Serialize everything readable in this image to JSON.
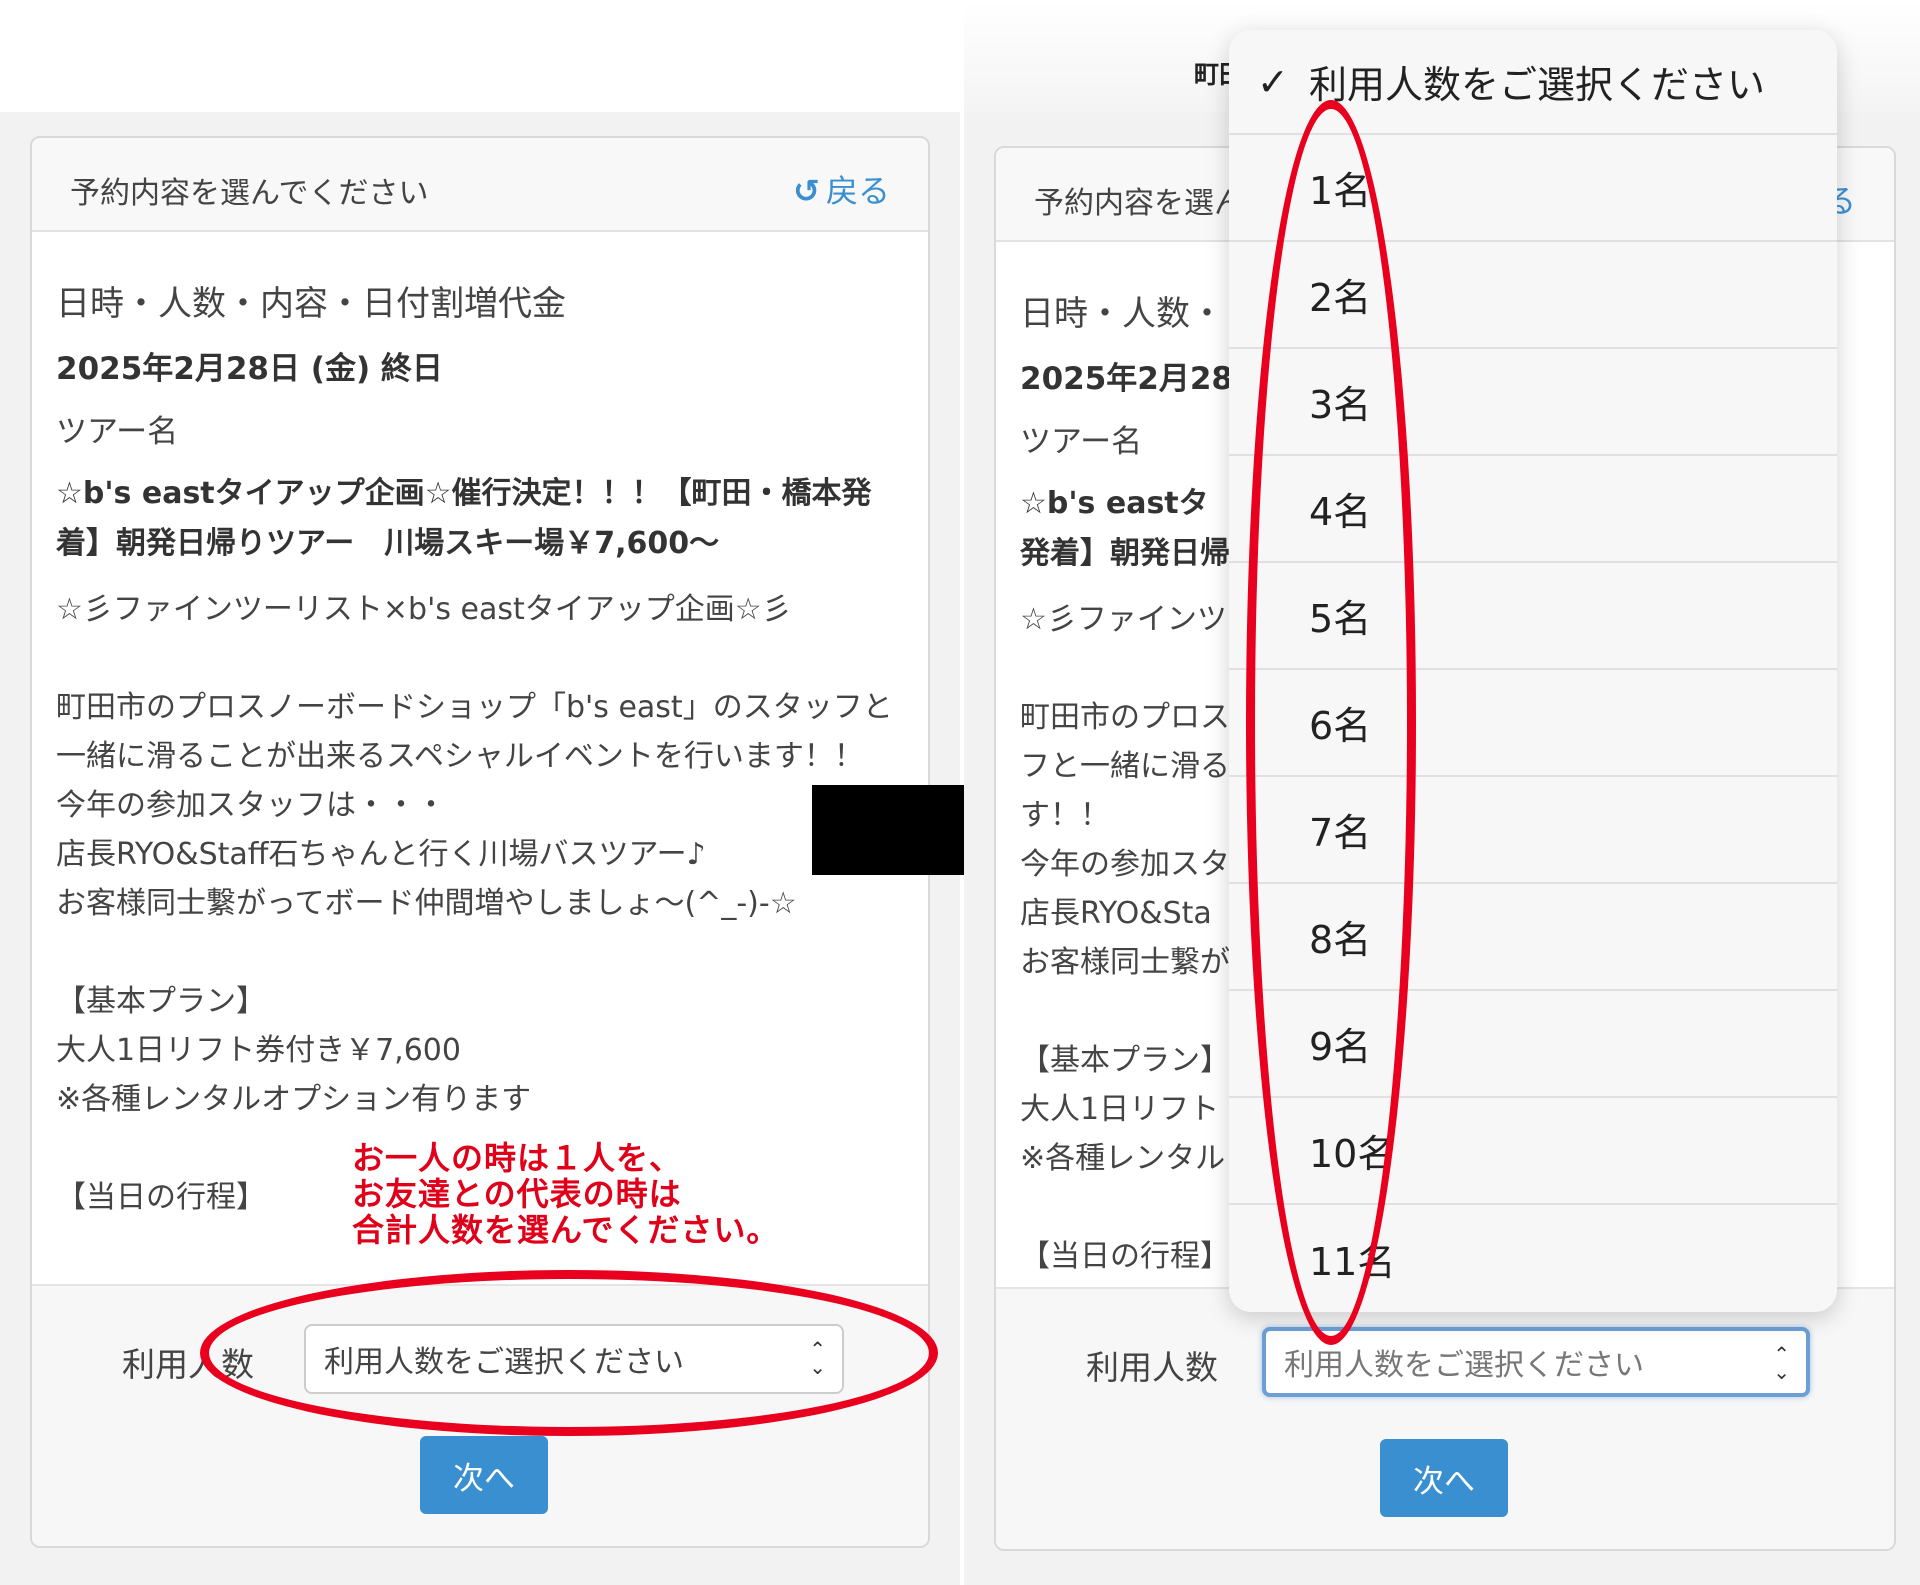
{
  "left": {
    "header_title": "予約内容を選んでください",
    "back_label": "戻る",
    "section_label": "日時・人数・内容・日付割増代金",
    "date_text": "2025年2月28日 (金) 終日",
    "tour_label": "ツアー名",
    "tour_title": "☆b's eastタイアップ企画☆催行決定！！！【町田・橋本発着】朝発日帰りツアー　川場スキー場￥7,600〜",
    "description": "☆彡ファインツーリスト×b's eastタイアップ企画☆彡\n\n町田市のプロスノーボードショップ「b's east」のスタッフと一緒に滑ることが出来るスペシャルイベントを行います！！\n今年の参加スタッフは・・・\n店長RYO&Staff石ちゃんと行く川場バスツアー♪\nお客様同士繋がってボード仲間増やしましょ〜(^_-)-☆\n\n【基本プラン】\n大人1日リフト券付き￥7,600\n※各種レンタルオプション有ります\n\n【当日の行程】",
    "people_label": "利用人数",
    "select_value": "利用人数をご選択ください",
    "next_label": "次へ",
    "annotation": "お一人の時は１人を、\nお友達との代表の時は\n合計人数を選んでください。"
  },
  "right": {
    "top_text": "町田",
    "header_title": "予約内容を選ん",
    "back_label": "る",
    "section_label": "日時・人数・",
    "date_text": "2025年2月28",
    "tour_label": "ツアー名",
    "tour_title": "☆b's eastタ\n発着】朝発日帰",
    "description": "☆彡ファインツ\n\n町田市のプロス\nフと一緒に滑る\nす！！\n今年の参加スタ\n店長RYO&Sta\nお客様同士繋が\n\n【基本プラン】\n大人1日リフト\n※各種レンタル\n\n【当日の行程】",
    "people_label": "利用人数",
    "select_value": "利用人数をご選択ください",
    "next_label": "次へ",
    "dropdown_options": [
      "利用人数をご選択ください",
      "1名",
      "2名",
      "3名",
      "4名",
      "5名",
      "6名",
      "7名",
      "8名",
      "9名",
      "10名",
      "11名"
    ],
    "selected_mark": "✓"
  },
  "colors": {
    "accent": "#3a8fd1",
    "annotation_red": "#e8001e"
  }
}
